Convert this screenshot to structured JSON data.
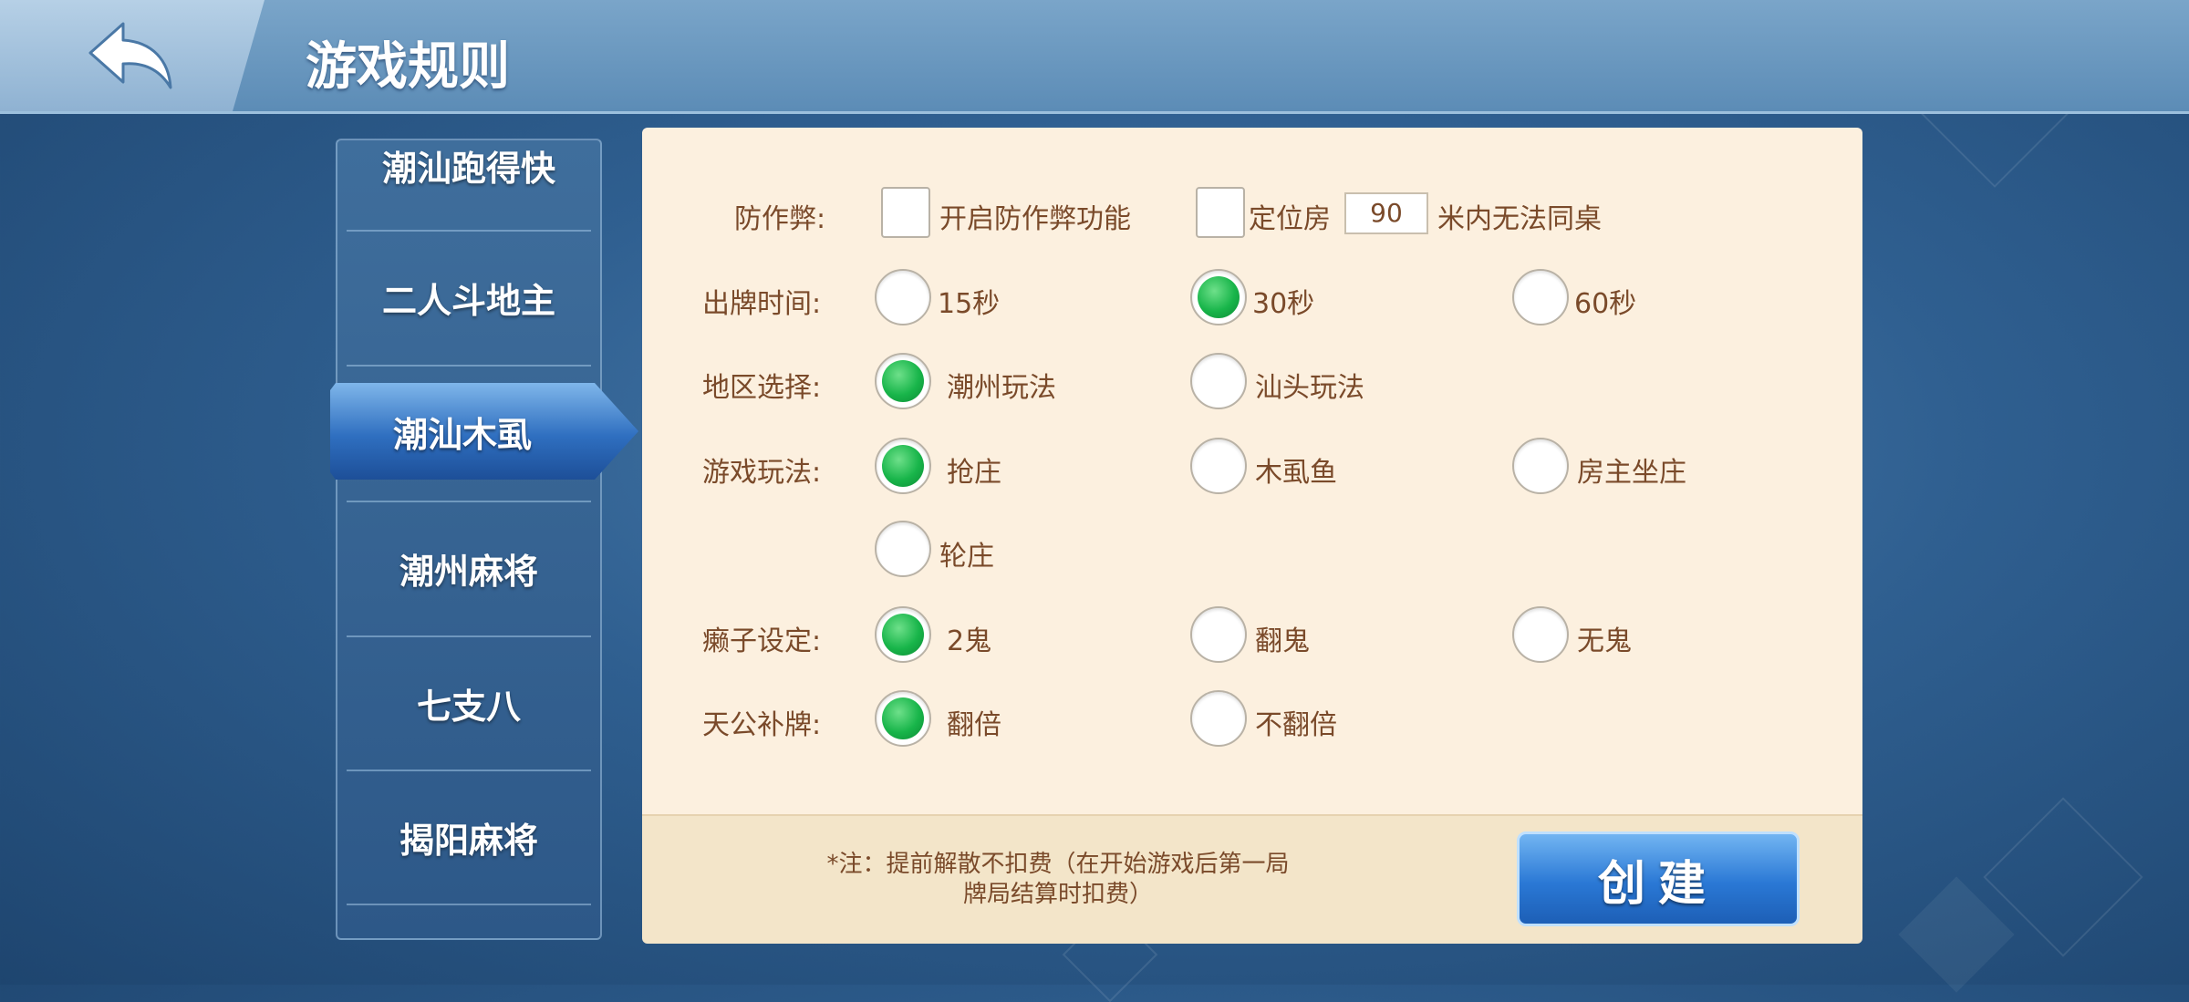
{
  "header": {
    "title": "游戏规则",
    "back_icon": "back-arrow-icon"
  },
  "sidebar": {
    "items": [
      {
        "label": "潮汕跑得快"
      },
      {
        "label": "二人斗地主"
      },
      {
        "label": "潮汕木虱",
        "active": true
      },
      {
        "label": "潮州麻将"
      },
      {
        "label": "七支八"
      },
      {
        "label": "揭阳麻将"
      }
    ]
  },
  "rules": {
    "anti_cheat": {
      "label": "防作弊:",
      "enable_label": "开启防作弊功能",
      "location_label": "定位房",
      "distance_value": "90",
      "distance_suffix": "米内无法同桌"
    },
    "play_time": {
      "label": "出牌时间:",
      "options": [
        "15秒",
        "30秒",
        "60秒"
      ],
      "selected": "30秒"
    },
    "region": {
      "label": "地区选择:",
      "options": [
        "潮州玩法",
        "汕头玩法"
      ],
      "selected": "潮州玩法"
    },
    "game_mode": {
      "label": "游戏玩法:",
      "options": [
        "抢庄",
        "木虱鱼",
        "房主坐庄",
        "轮庄"
      ],
      "selected": "抢庄"
    },
    "wildcard": {
      "label": "癞子设定:",
      "options": [
        "2鬼",
        "翻鬼",
        "无鬼"
      ],
      "selected": "2鬼"
    },
    "tiangong": {
      "label": "天公补牌:",
      "options": [
        "翻倍",
        "不翻倍"
      ],
      "selected": "翻倍"
    }
  },
  "footer": {
    "note_line1": "*注：提前解散不扣费（在开始游戏后第一局",
    "note_line2": "牌局结算时扣费）",
    "create_label": "创建"
  },
  "colors": {
    "selected_radio": "#18b54a",
    "text": "#7a4a2a",
    "accent": "#2a78d5"
  }
}
